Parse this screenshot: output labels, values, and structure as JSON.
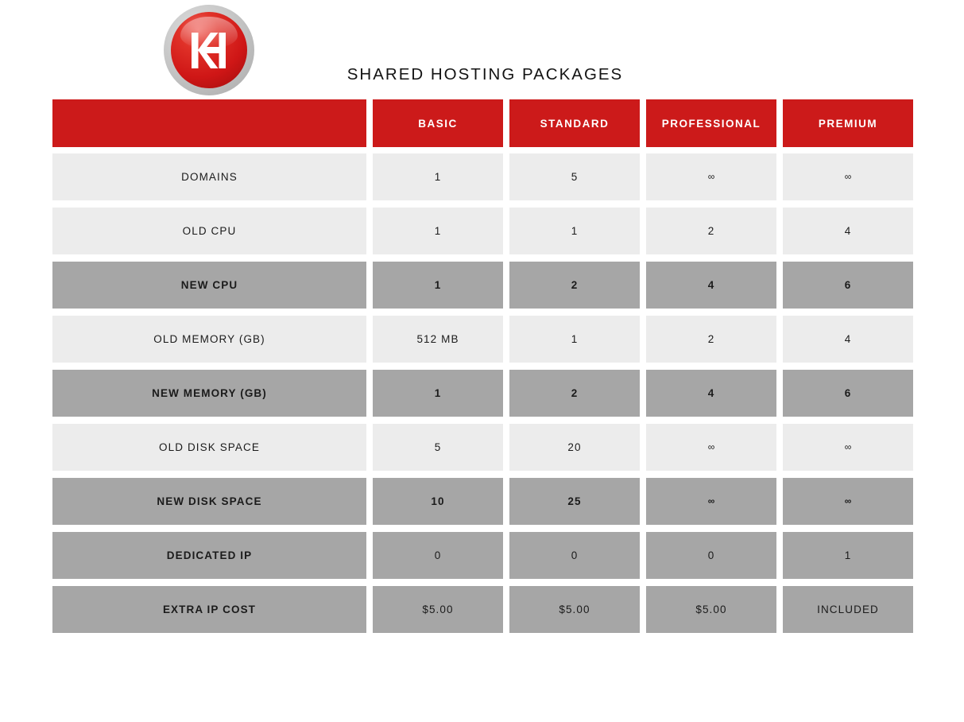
{
  "brand": {
    "logo_name": "kh-logo",
    "logo_letters": "KH",
    "logo_ring_color": "#bdbdbd",
    "logo_sphere_color": "#cf1a1a"
  },
  "title": "SHARED HOSTING PACKAGES",
  "colors": {
    "accent_red": "#cc1a1a",
    "row_light": "#ececec",
    "row_dark": "#a6a6a6",
    "text": "#1b1b1b",
    "header_text": "#ffffff",
    "page_background": "#ffffff"
  },
  "table": {
    "columns": [
      {
        "key": "feature",
        "label": ""
      },
      {
        "key": "basic",
        "label": "BASIC"
      },
      {
        "key": "standard",
        "label": "STANDARD"
      },
      {
        "key": "professional",
        "label": "PROFESSIONAL"
      },
      {
        "key": "premium",
        "label": "PREMIUM"
      }
    ],
    "rows": [
      {
        "label": "DOMAINS",
        "style": "light",
        "values": [
          "1",
          "5",
          "∞",
          "∞"
        ]
      },
      {
        "label": "OLD CPU",
        "style": "light",
        "values": [
          "1",
          "1",
          "2",
          "4"
        ]
      },
      {
        "label": "NEW CPU",
        "style": "dark",
        "values": [
          "1",
          "2",
          "4",
          "6"
        ]
      },
      {
        "label": "OLD MEMORY (GB)",
        "style": "light",
        "values": [
          "512 MB",
          "1",
          "2",
          "4"
        ]
      },
      {
        "label": "NEW MEMORY (GB)",
        "style": "dark",
        "values": [
          "1",
          "2",
          "4",
          "6"
        ]
      },
      {
        "label": "OLD DISK SPACE",
        "style": "light",
        "values": [
          "5",
          "20",
          "∞",
          "∞"
        ]
      },
      {
        "label": "NEW DISK SPACE",
        "style": "dark",
        "values": [
          "10",
          "25",
          "∞",
          "∞"
        ]
      },
      {
        "label": "DEDICATED IP",
        "style": "dark-label-bold",
        "values": [
          "0",
          "0",
          "0",
          "1"
        ]
      },
      {
        "label": "EXTRA IP COST",
        "style": "dark-label-bold",
        "values": [
          "$5.00",
          "$5.00",
          "$5.00",
          "INCLUDED"
        ]
      }
    ]
  }
}
